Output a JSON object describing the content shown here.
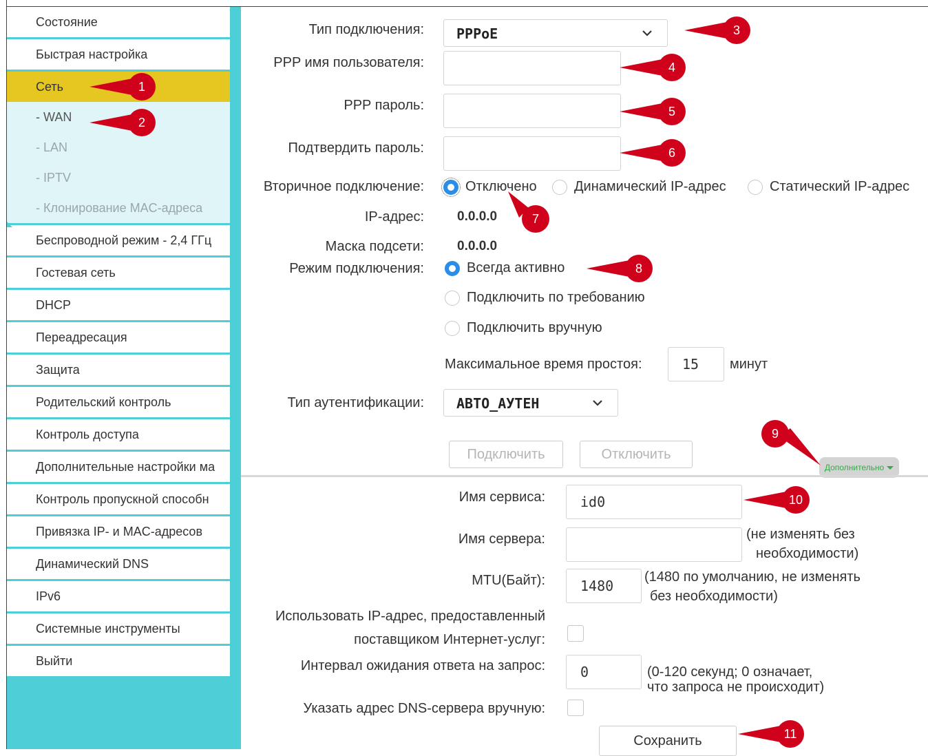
{
  "sidebar": {
    "items_top": [
      "Состояние",
      "Быстрая настройка"
    ],
    "active": "Сеть",
    "submenu": [
      "- WAN",
      "- LAN",
      "- IPTV",
      "- Клонирование MAC-адреса"
    ],
    "items_bottom": [
      "Беспроводной режим - 2,4 ГГц",
      "Гостевая сеть",
      "DHCP",
      "Переадресация",
      "Защита",
      "Родительский контроль",
      "Контроль доступа",
      "Дополнительные настройки ма",
      "Контроль пропускной способн",
      "Привязка IP- и MAC-адресов",
      "Динамический DNS",
      "IPv6",
      "Системные инструменты",
      "Выйти"
    ]
  },
  "form": {
    "conn_type_label": "Тип подключения:",
    "conn_type_value": "PPPoE",
    "ppp_user_label": "PPP имя пользователя:",
    "ppp_pass_label": "PPP пароль:",
    "confirm_pass_label": "Подтвердить пароль:",
    "secondary_label": "Вторичное подключение:",
    "secondary_options": [
      "Отключено",
      "Динамический IP-адрес",
      "Статический IP-адрес"
    ],
    "ip_label": "IP-адрес:",
    "ip_value": "0.0.0.0",
    "mask_label": "Маска подсети:",
    "mask_value": "0.0.0.0",
    "mode_label": "Режим подключения:",
    "mode_options": [
      "Всегда активно",
      "Подключить по требованию",
      "Подключить вручную"
    ],
    "idle_label": "Максимальное время простоя:",
    "idle_value": "15",
    "idle_unit": "минут",
    "auth_label": "Тип аутентификации:",
    "auth_value": "АВТО_АУТЕН",
    "connect_btn": "Подключить",
    "disconnect_btn": "Отключить",
    "advanced_label": "Дополнительно"
  },
  "advanced": {
    "service_label": "Имя сервиса:",
    "service_value": "id0",
    "server_label": "Имя сервера:",
    "server_note_1": "(не изменять без",
    "server_note_2": "необходимости)",
    "mtu_label": "MTU(Байт):",
    "mtu_value": "1480",
    "mtu_note_1": "(1480 по умолчанию, не изменять",
    "mtu_note_2": "без необходимости)",
    "isp_ip_label_1": "Использовать IP-адрес, предоставленный",
    "isp_ip_label_2": "поставщиком Интернет-услуг:",
    "interval_label": "Интервал ожидания ответа на запрос:",
    "interval_value": "0",
    "interval_note_1": "(0-120 секунд; 0 означает,",
    "interval_note_2": "что запроса не происходит)",
    "dns_label": "Указать адрес DNS-сервера вручную:",
    "save_btn": "Сохранить"
  },
  "markers": [
    "1",
    "2",
    "3",
    "4",
    "5",
    "6",
    "7",
    "8",
    "9",
    "10",
    "11"
  ],
  "colors": {
    "sidebar": "#4ecfd8",
    "active_item": "#e6c722",
    "radio_on": "#2a8ee8",
    "marker": "#d0021b"
  }
}
